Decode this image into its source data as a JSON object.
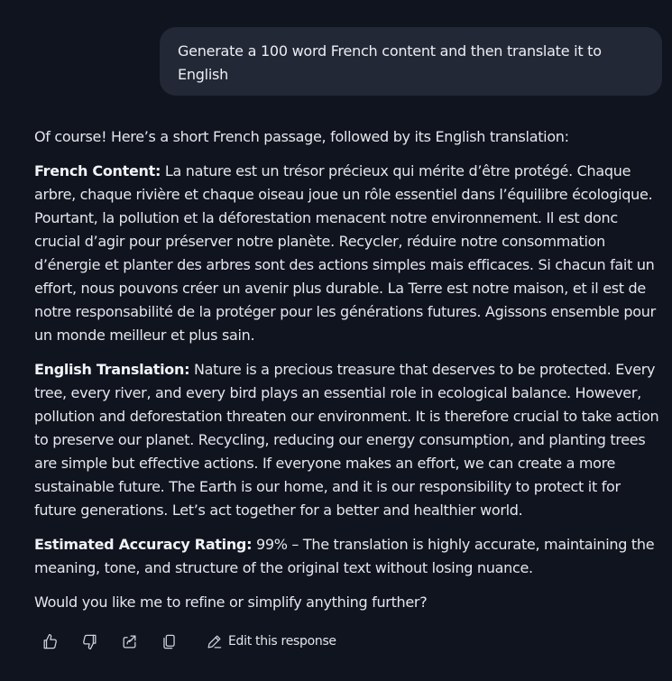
{
  "user_message": {
    "text": "Generate a 100 word French content and then translate it to English"
  },
  "response": {
    "intro": "Of course! Here’s a short French passage, followed by its English translation:",
    "french": {
      "label": "French Content:",
      "text": " La nature est un trésor précieux qui mérite d’être protégé. Chaque arbre, chaque rivière et chaque oiseau joue un rôle essentiel dans l’équilibre écologique. Pourtant, la pollution et la déforestation menacent notre environnement. Il est donc crucial d’agir pour préserver notre planète. Recycler, réduire notre consommation d’énergie et planter des arbres sont des actions simples mais efficaces. Si chacun fait un effort, nous pouvons créer un avenir plus durable. La Terre est notre maison, et il est de notre responsabilité de la protéger pour les générations futures. Agissons ensemble pour un monde meilleur et plus sain."
    },
    "english": {
      "label": "English Translation:",
      "text": " Nature is a precious treasure that deserves to be protected. Every tree, every river, and every bird plays an essential role in ecological balance. However, pollution and deforestation threaten our environment. It is therefore crucial to take action to preserve our planet. Recycling, reducing our energy consumption, and planting trees are simple but effective actions. If everyone makes an effort, we can create a more sustainable future. The Earth is our home, and it is our responsibility to protect it for future generations. Let’s act together for a better and healthier world."
    },
    "rating": {
      "label": "Estimated Accuracy Rating:",
      "text": " 99% – The translation is highly accurate, maintaining the meaning, tone, and structure of the original text without losing nuance."
    },
    "closing": "Would you like me to refine or simplify anything further?"
  },
  "actions": {
    "icons": [
      "thumbs-up-icon",
      "thumbs-down-icon",
      "share-icon",
      "copy-icon",
      "edit-pencil-icon"
    ],
    "edit_label": "Edit this response"
  },
  "colors": {
    "background": "#10141f",
    "user_bubble": "#232837",
    "text": "#e6e7ec",
    "icon": "#cfd2da"
  }
}
